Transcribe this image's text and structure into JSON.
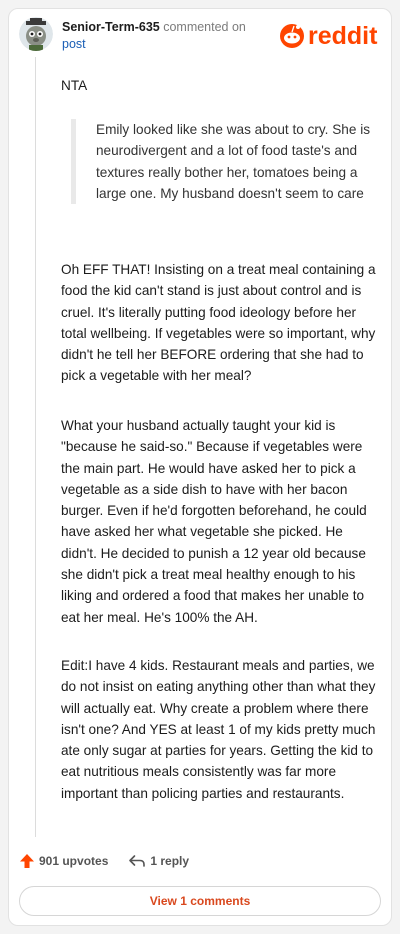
{
  "header": {
    "author": "Senior-Term-635",
    "action_text": "commented on",
    "post_link": "post",
    "logo_text": "reddit"
  },
  "comment": {
    "verdict": "NTA",
    "quote": "Emily looked like she was about to cry. She is neurodivergent and a lot of food taste's and textures really bother her, tomatoes being a large one. My husband doesn't seem to care",
    "paragraphs": [
      "Oh EFF THAT! Insisting on a treat meal containing a food the kid can't stand is just about control and is cruel. It's literally putting food ideology before her total wellbeing. If vegetables were so important, why didn't he tell her BEFORE ordering that she had to pick a vegetable with her meal?",
      "What your husband actually taught your kid is \"because he said-so.\" Because if vegetables were the main part. He would have asked her to pick a vegetable as a side dish to have with her bacon burger. Even if he'd forgotten beforehand, he could have asked her what vegetable she picked. He didn't. He decided to punish a 12 year old because she didn't pick a treat meal healthy enough to his liking and ordered a food that makes her unable to eat her meal. He's 100% the AH.",
      "Edit:I have 4 kids. Restaurant meals and parties, we do not insist on eating anything other than what they will actually eat. Why create a problem where there isn't one? And YES at least 1 of my kids pretty much ate only sugar at parties for years. Getting the kid to eat nutritious meals consistently was far more important than policing parties and restaurants."
    ]
  },
  "actions": {
    "upvotes": "901 upvotes",
    "replies": "1 reply",
    "view_comments": "View 1 comments"
  },
  "colors": {
    "brand": "#ff4500",
    "link": "#1a5eb5",
    "view_button_text": "#d9481e"
  }
}
